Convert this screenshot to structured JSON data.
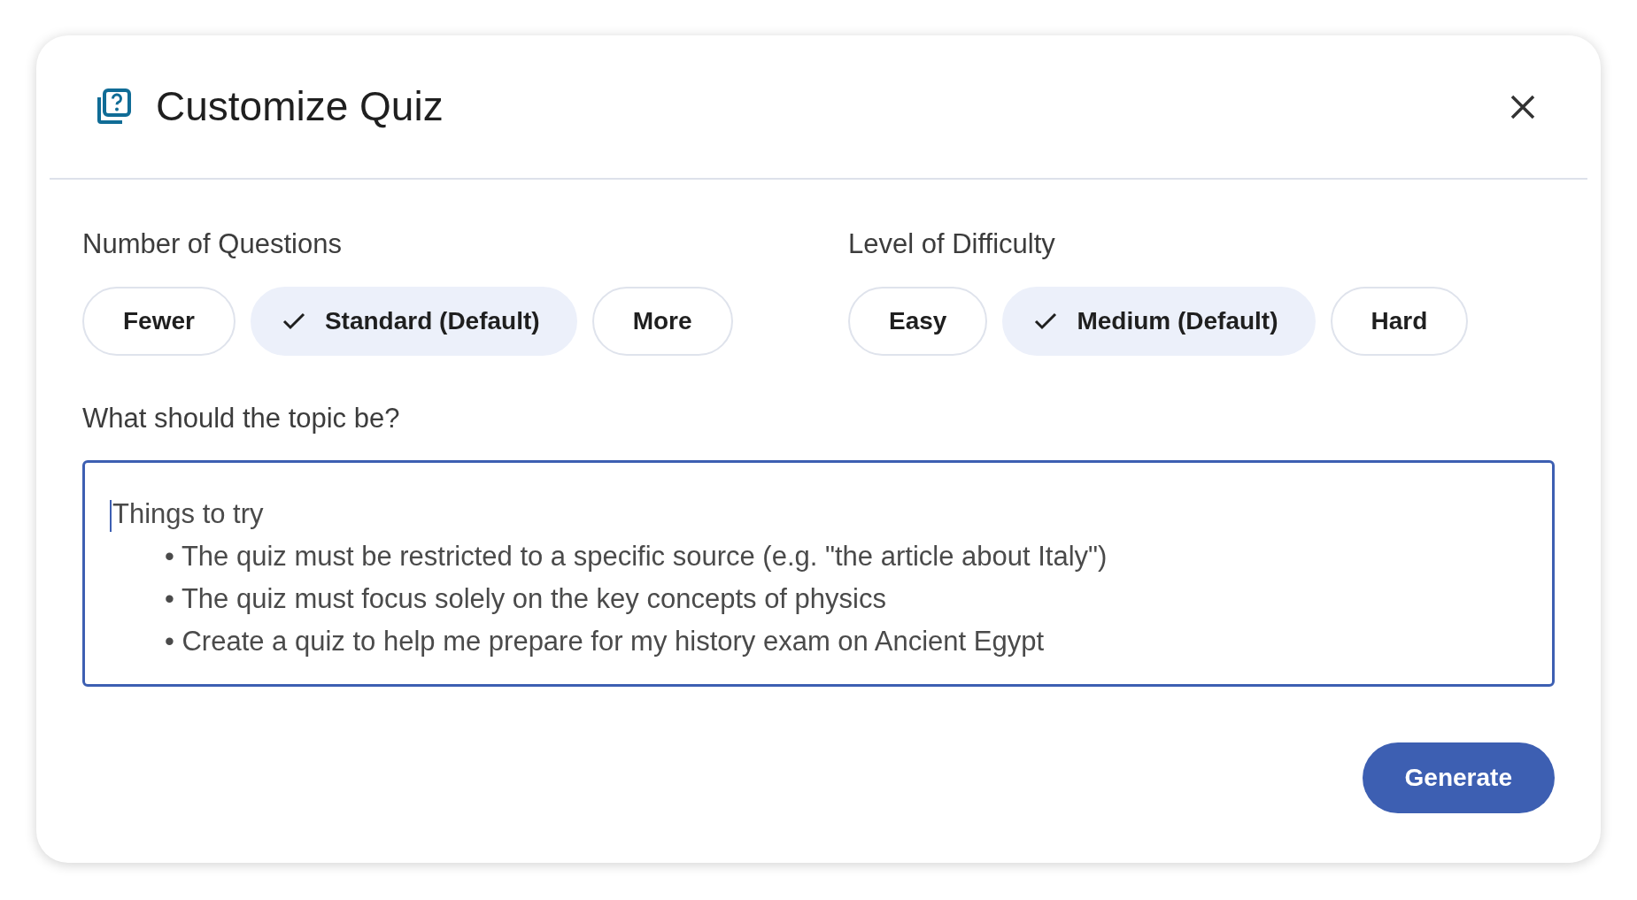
{
  "dialog": {
    "title": "Customize Quiz"
  },
  "groups": [
    {
      "label": "Number of Questions",
      "options": [
        {
          "label": "Fewer",
          "selected": false
        },
        {
          "label": "Standard (Default)",
          "selected": true
        },
        {
          "label": "More",
          "selected": false
        }
      ]
    },
    {
      "label": "Level of Difficulty",
      "options": [
        {
          "label": "Easy",
          "selected": false
        },
        {
          "label": "Medium (Default)",
          "selected": true
        },
        {
          "label": "Hard",
          "selected": false
        }
      ]
    }
  ],
  "topic": {
    "label": "What should the topic be?",
    "placeholder": {
      "title": "Things to try",
      "examples": [
        "• The quiz must be restricted to a specific source (e.g. \"the article about Italy\")",
        "• The quiz must focus solely on the key concepts of physics",
        "• Create a quiz to help me prepare for my history exam on Ancient Egypt"
      ]
    }
  },
  "buttons": [
    "Generate"
  ]
}
